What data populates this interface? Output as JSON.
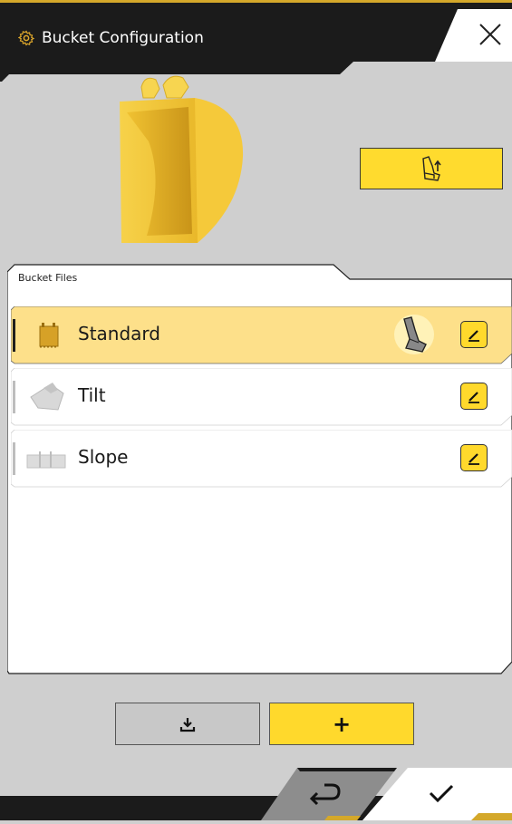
{
  "header": {
    "title": "Bucket Configuration",
    "title_icon": "gear-icon",
    "close_icon": "close-icon"
  },
  "preview": {
    "bucket_image": "bucket-preview-image",
    "assign_icon": "bucket-assign-icon"
  },
  "files": {
    "title": "Bucket Files",
    "items": [
      {
        "label": "Standard",
        "icon": "standard-bucket-icon",
        "selected": true,
        "active": true
      },
      {
        "label": "Tilt",
        "icon": "tilt-bucket-icon",
        "selected": false,
        "active": false
      },
      {
        "label": "Slope",
        "icon": "slope-bucket-icon",
        "selected": false,
        "active": false
      }
    ],
    "edit_icon": "edit-icon"
  },
  "actions": {
    "import_icon": "import-icon",
    "add_label": "+"
  },
  "footer": {
    "back_icon": "return-icon",
    "ok_icon": "checkmark-icon"
  },
  "colors": {
    "accent": "#ffd92c",
    "selected_row": "#fde08a",
    "header_bg": "#1a1a1a",
    "background": "#cfcfcf"
  }
}
